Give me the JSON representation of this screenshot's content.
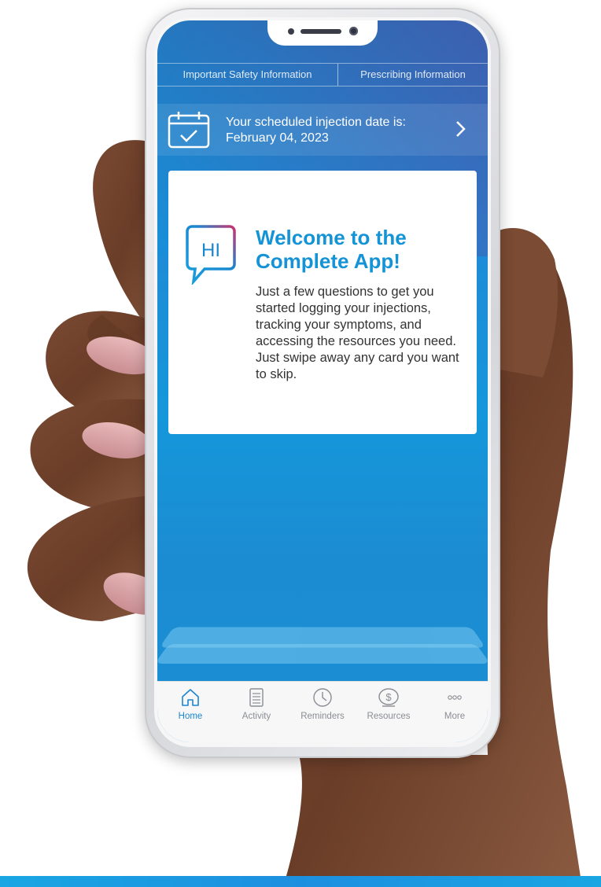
{
  "header": {
    "links": [
      {
        "label": "Important Safety Information"
      },
      {
        "label": "Prescribing Information"
      }
    ]
  },
  "injection_banner": {
    "line1": "Your scheduled injection date is:",
    "line2": "February 04, 2023",
    "icon": "calendar-check-icon"
  },
  "welcome_card": {
    "icon_text": "HI",
    "title": "Welcome to the Complete App!",
    "body": "Just a few questions to get you started logging your injections, tracking your symptoms, and accessing the resources you need. Just swipe away any card you want to skip."
  },
  "tab_bar": {
    "active": "Home",
    "tabs": [
      {
        "label": "Home",
        "icon": "home-icon"
      },
      {
        "label": "Activity",
        "icon": "document-icon"
      },
      {
        "label": "Reminders",
        "icon": "clock-icon"
      },
      {
        "label": "Resources",
        "icon": "dollar-icon"
      },
      {
        "label": "More",
        "icon": "more-dots-icon"
      }
    ]
  },
  "colors": {
    "accent": "#1493d6",
    "screen_top": "#2d6db5",
    "screen_bottom": "#1a8fd4",
    "swoosh": "#19a6e3"
  }
}
